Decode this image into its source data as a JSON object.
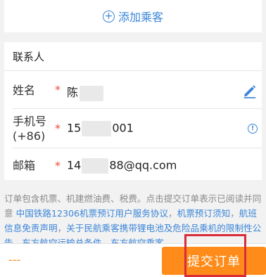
{
  "add_passenger": {
    "icon": "plus-circle-icon",
    "label": "添加乘客"
  },
  "contact": {
    "title": "联系人",
    "required_mark": "*",
    "name": {
      "label": "姓名",
      "value": "陈"
    },
    "phone": {
      "label_line1": "手机号",
      "label_line2": "(+86)",
      "prefix": "15",
      "suffix": "001"
    },
    "email": {
      "label": "邮箱",
      "prefix": "14",
      "suffix": "88@qq.com"
    }
  },
  "notice": {
    "text1": "订单包含机票、机建燃油费、税费。点击提交订单表示已阅读并同意 ",
    "link1": "中国铁路12306机票预订用户服务协议",
    "text2": "，",
    "link2": "机票预订须知",
    "text3": "，",
    "link3": "航班信息免责声明",
    "text4": "，",
    "link4": "关于民航乘客携带锂电池及危险品乘机的限制性公告",
    "text5": "，",
    "link5": "东方航空运输总条件",
    "text6": "，",
    "link6": "东方航空乘客"
  },
  "bottom_bar": {
    "price": "---",
    "submit_label": "提交订单"
  },
  "colors": {
    "accent": "#3b85d8",
    "submit": "#ff8c1a",
    "required": "#e84a3c",
    "highlight": "#d92b3a"
  }
}
